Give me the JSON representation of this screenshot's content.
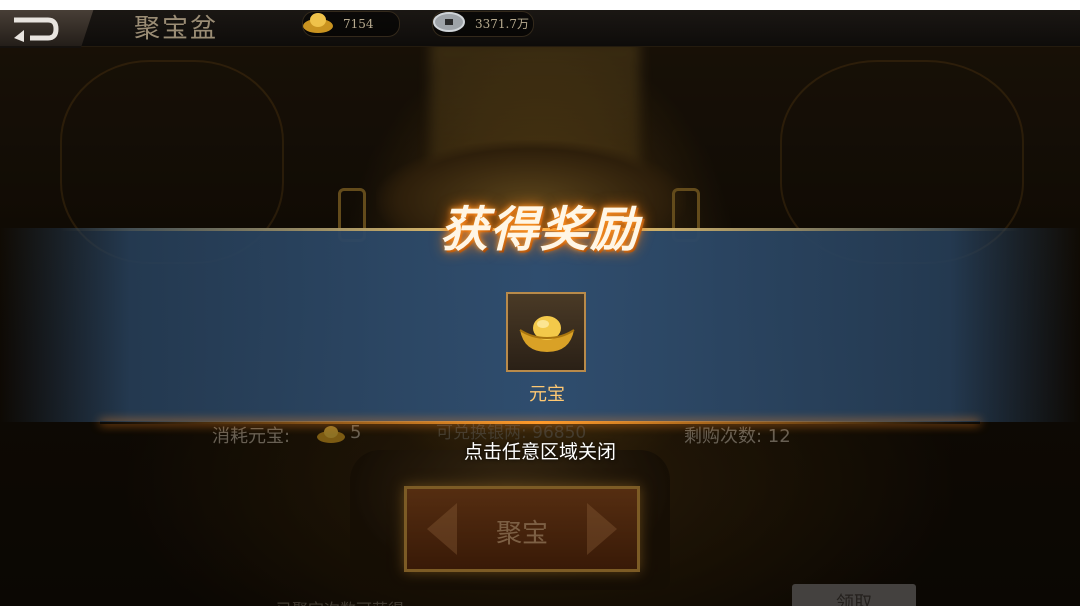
{
  "header": {
    "title": "聚宝盆",
    "ingot_amount": "7154",
    "coin_amount": "3371.7万"
  },
  "background": {
    "cost_label": "消耗元宝:",
    "cost_value": "5",
    "exchange_label": "可兑换银两:",
    "exchange_value": "96850",
    "remaining_label": "剩购次数: 12",
    "action_button": "聚宝",
    "bottom_text": "已聚宝次数可获得",
    "claim_button": "领取"
  },
  "reward_popup": {
    "title": "获得奖励",
    "items": [
      {
        "name": "元宝",
        "icon": "gold-ingot-icon"
      }
    ],
    "close_hint": "点击任意区域关闭"
  },
  "colors": {
    "title_glow": "#ff9c2a",
    "banner": "#2f4d6e",
    "item_label": "#ffc872",
    "button_border": "#c9943c"
  }
}
